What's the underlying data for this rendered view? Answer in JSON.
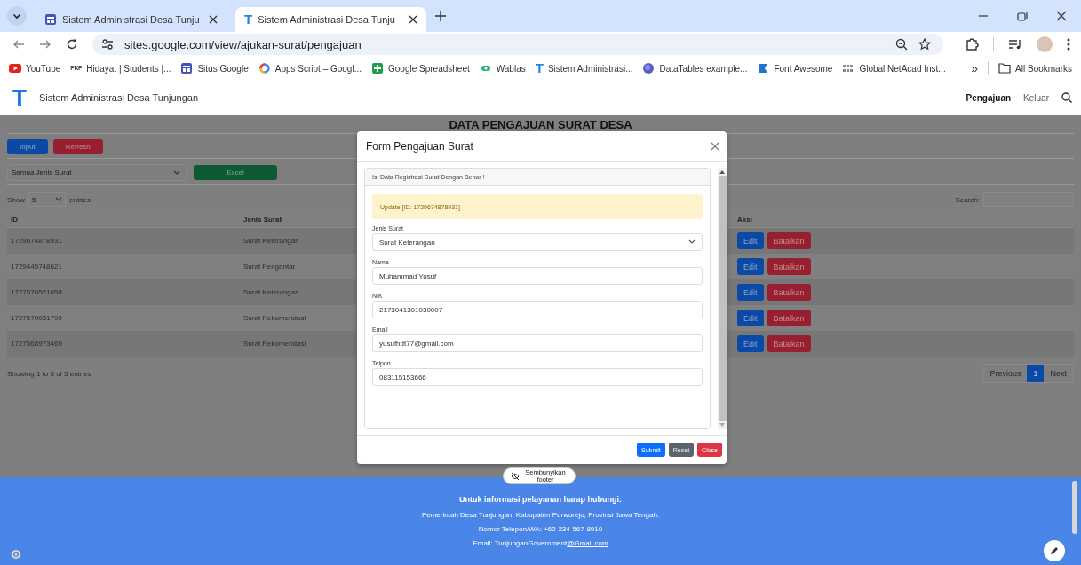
{
  "browser": {
    "tabs": [
      {
        "title": "Sistem Administrasi Desa Tunju",
        "selected": false
      },
      {
        "title": "Sistem Administrasi Desa Tunju",
        "selected": true,
        "logo": "T"
      }
    ],
    "url": "sites.google.com/view/ajukan-surat/pengajuan",
    "bookmarks": [
      {
        "label": "YouTube"
      },
      {
        "label": "Hidayat | Students |...",
        "logo": "PKP"
      },
      {
        "label": "Situs Google"
      },
      {
        "label": "Apps Script – Googl..."
      },
      {
        "label": "Google Spreadsheet"
      },
      {
        "label": "Wablas"
      },
      {
        "label": "Sistem Administrasi...",
        "logo": "T"
      },
      {
        "label": "DataTables example..."
      },
      {
        "label": "Font Awesome"
      },
      {
        "label": "Global NetAcad Inst..."
      }
    ],
    "overflow": "»",
    "all_bookmarks": "All Bookmarks"
  },
  "site": {
    "logo": "T",
    "title": "Sistem Administrasi Desa Tunjungan",
    "nav": [
      {
        "label": "Pengajuan",
        "selected": true
      },
      {
        "label": "Keluar",
        "selected": false
      }
    ]
  },
  "page": {
    "title": "DATA PENGAJUAN SURAT DESA",
    "buttons": [
      {
        "label": "Input",
        "kind": "primary"
      },
      {
        "label": "Refresh",
        "kind": "danger"
      }
    ],
    "filter": {
      "value": "Semua Jenis Surat"
    },
    "export": {
      "label": "Excel",
      "kind": "success"
    },
    "length": {
      "before": "Show",
      "value": "5",
      "after": "entries"
    },
    "search_label": "Search:",
    "table": {
      "columns": [
        "ID",
        "Jenis Surat",
        "Aksi"
      ],
      "rows": [
        {
          "id": "1729674878931",
          "jenis": "Surat Keterangan",
          "actions": [
            {
              "label": "Edit",
              "kind": "primary"
            },
            {
              "label": "Batalkan",
              "kind": "danger"
            }
          ]
        },
        {
          "id": "1729445748621",
          "jenis": "Surat Pengantar",
          "actions": [
            {
              "label": "Edit",
              "kind": "primary"
            },
            {
              "label": "Batalkan",
              "kind": "danger"
            }
          ]
        },
        {
          "id": "1727570521058",
          "jenis": "Surat Keterangan",
          "actions": [
            {
              "label": "Edit",
              "kind": "primary"
            },
            {
              "label": "Batalkan",
              "kind": "danger"
            }
          ]
        },
        {
          "id": "1727570031799",
          "jenis": "Surat Rekomendasi",
          "actions": [
            {
              "label": "Edit",
              "kind": "primary"
            },
            {
              "label": "Batalkan",
              "kind": "danger"
            }
          ]
        },
        {
          "id": "1727568973469",
          "jenis": "Surat Rekomendasi",
          "actions": [
            {
              "label": "Edit",
              "kind": "primary"
            },
            {
              "label": "Batalkan",
              "kind": "danger"
            }
          ]
        }
      ]
    },
    "info": "Showing 1 to 5 of 5 entries",
    "pagination": [
      {
        "label": "Previous",
        "selected": false
      },
      {
        "label": "1",
        "selected": true
      },
      {
        "label": "Next",
        "selected": false
      }
    ]
  },
  "modal": {
    "title": "Form Pengajuan Surat",
    "card_header": "Isi Data Registrasi Surat Dengan Benar !",
    "alert": "Update [ID: 1729674878931]",
    "fields": [
      {
        "label": "Jenis Surat",
        "kind": "select",
        "value": "Surat Keterangan"
      },
      {
        "label": "Nama",
        "kind": "input",
        "value": "Muhammad Yusuf"
      },
      {
        "label": "NIK",
        "kind": "input",
        "value": "2173041301030007"
      },
      {
        "label": "Email",
        "kind": "input",
        "value": "yusufhdt77@gmail.com"
      },
      {
        "label": "Telpon",
        "kind": "input",
        "value": "083115153666"
      }
    ],
    "buttons": [
      {
        "label": "Submit",
        "kind": "primary"
      },
      {
        "label": "Reset",
        "kind": "secondary"
      },
      {
        "label": "Close",
        "kind": "danger"
      }
    ]
  },
  "footer": {
    "toggle": "Sembunyikan footer",
    "heading": "Untuk informasi pelayanan harap hubungi:",
    "lines": [
      "Pemerintah Desa Tunjungan, Kabupaten Purworejo, Provinsi Jawa Tengah.",
      "Nomor Telepon/WA: +62-234-567-8910"
    ],
    "email_text": "Email: TunjunganGovernment",
    "email_link": "@Gmail.com"
  }
}
